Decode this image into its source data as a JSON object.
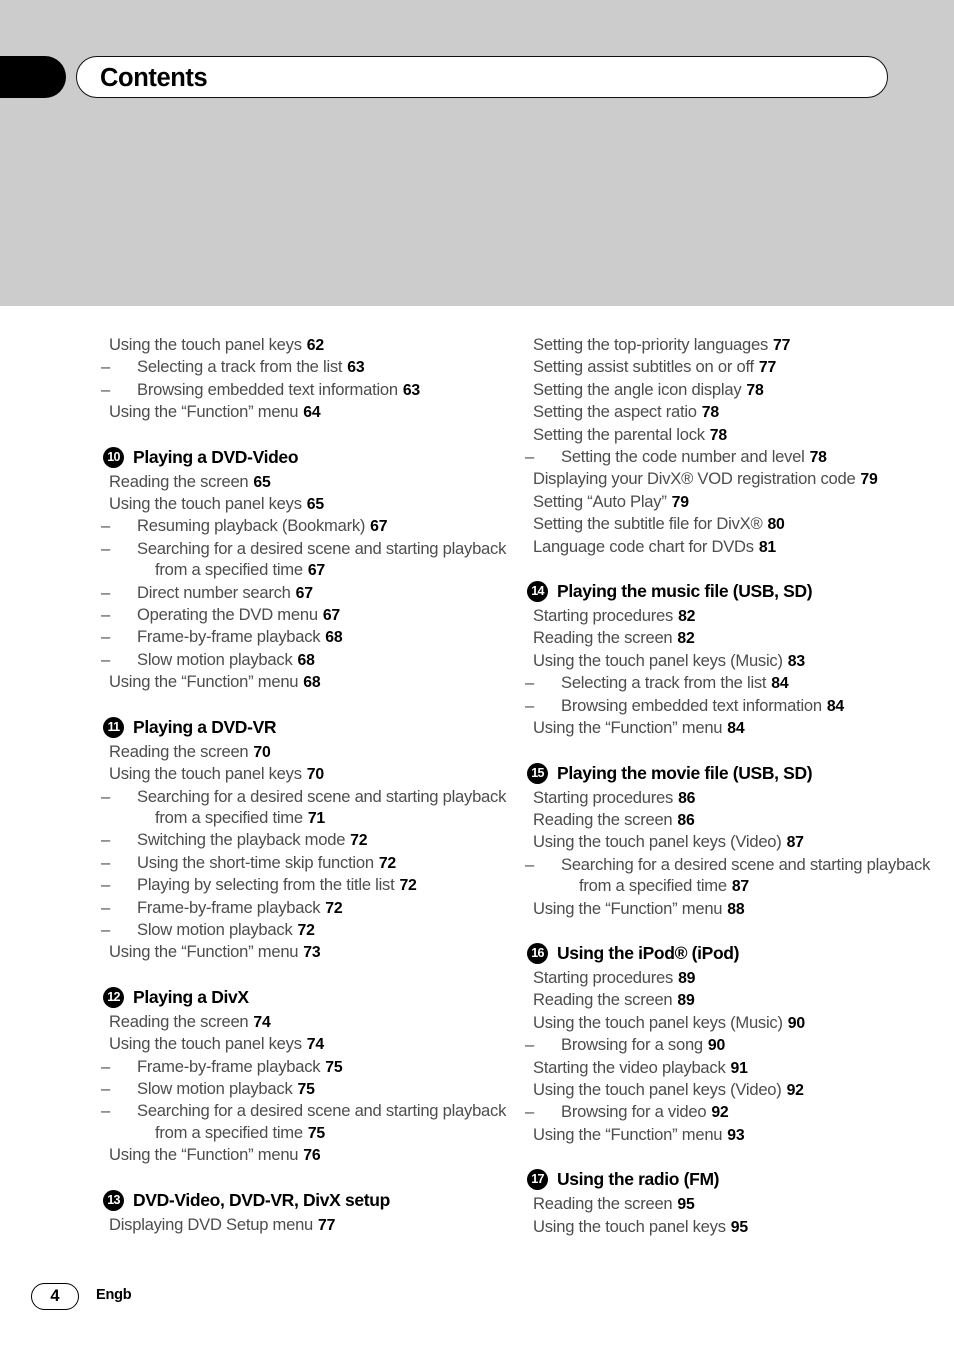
{
  "header": {
    "title": "Contents"
  },
  "footer": {
    "page_number": "4",
    "language_code": "Engb"
  },
  "columns": [
    {
      "name": "left-column",
      "sections": [
        {
          "badge": null,
          "title": null,
          "spaced": false,
          "entries": [
            {
              "level": 1,
              "text": "Using the touch panel keys",
              "page": "62"
            },
            {
              "level": 2,
              "text": "Selecting a track from the list",
              "page": "63"
            },
            {
              "level": 2,
              "text": "Browsing embedded text information",
              "page": "63"
            },
            {
              "level": 1,
              "text": "Using the “Function” menu",
              "page": "64"
            }
          ]
        },
        {
          "badge": "10",
          "title": "Playing a DVD-Video",
          "spaced": true,
          "entries": [
            {
              "level": 1,
              "text": "Reading the screen",
              "page": "65"
            },
            {
              "level": 1,
              "text": "Using the touch panel keys",
              "page": "65"
            },
            {
              "level": 2,
              "text": "Resuming playback (Bookmark)",
              "page": "67"
            },
            {
              "level": 2,
              "text": "Searching for a desired scene and starting playback from a specified time",
              "page": "67"
            },
            {
              "level": 2,
              "text": "Direct number search",
              "page": "67"
            },
            {
              "level": 2,
              "text": "Operating the DVD menu",
              "page": "67"
            },
            {
              "level": 2,
              "text": "Frame-by-frame playback",
              "page": "68"
            },
            {
              "level": 2,
              "text": "Slow motion playback",
              "page": "68"
            },
            {
              "level": 1,
              "text": "Using the “Function” menu",
              "page": "68"
            }
          ]
        },
        {
          "badge": "11",
          "title": "Playing a DVD-VR",
          "spaced": true,
          "entries": [
            {
              "level": 1,
              "text": "Reading the screen",
              "page": "70"
            },
            {
              "level": 1,
              "text": "Using the touch panel keys",
              "page": "70"
            },
            {
              "level": 2,
              "text": "Searching for a desired scene and starting playback from a specified time",
              "page": "71"
            },
            {
              "level": 2,
              "text": "Switching the playback mode",
              "page": "72"
            },
            {
              "level": 2,
              "text": "Using the short-time skip function",
              "page": "72"
            },
            {
              "level": 2,
              "text": "Playing by selecting from the title list",
              "page": "72"
            },
            {
              "level": 2,
              "text": "Frame-by-frame playback",
              "page": "72"
            },
            {
              "level": 2,
              "text": "Slow motion playback",
              "page": "72"
            },
            {
              "level": 1,
              "text": "Using the “Function” menu",
              "page": "73"
            }
          ]
        },
        {
          "badge": "12",
          "title": "Playing a DivX",
          "spaced": true,
          "entries": [
            {
              "level": 1,
              "text": "Reading the screen",
              "page": "74"
            },
            {
              "level": 1,
              "text": "Using the touch panel keys",
              "page": "74"
            },
            {
              "level": 2,
              "text": "Frame-by-frame playback",
              "page": "75"
            },
            {
              "level": 2,
              "text": "Slow motion playback",
              "page": "75"
            },
            {
              "level": 2,
              "text": "Searching for a desired scene and starting playback from a specified time",
              "page": "75"
            },
            {
              "level": 1,
              "text": "Using the “Function” menu",
              "page": "76"
            }
          ]
        },
        {
          "badge": "13",
          "title": "DVD-Video, DVD-VR, DivX setup",
          "spaced": true,
          "entries": [
            {
              "level": 1,
              "text": "Displaying DVD Setup menu",
              "page": "77"
            }
          ]
        }
      ]
    },
    {
      "name": "right-column",
      "sections": [
        {
          "badge": null,
          "title": null,
          "spaced": false,
          "entries": [
            {
              "level": 1,
              "text": "Setting the top-priority languages",
              "page": "77"
            },
            {
              "level": 1,
              "text": "Setting assist subtitles on or off",
              "page": "77"
            },
            {
              "level": 1,
              "text": "Setting the angle icon display",
              "page": "78"
            },
            {
              "level": 1,
              "text": "Setting the aspect ratio",
              "page": "78"
            },
            {
              "level": 1,
              "text": "Setting the parental lock",
              "page": "78"
            },
            {
              "level": 2,
              "text": "Setting the code number and level",
              "page": "78"
            },
            {
              "level": 1,
              "text": "Displaying your DivX® VOD registration code",
              "page": "79"
            },
            {
              "level": 1,
              "text": "Setting “Auto Play”",
              "page": "79"
            },
            {
              "level": 1,
              "text": "Setting the subtitle file for DivX®",
              "page": "80"
            },
            {
              "level": 1,
              "text": "Language code chart for DVDs",
              "page": "81"
            }
          ]
        },
        {
          "badge": "14",
          "title": "Playing the music file (USB, SD)",
          "spaced": true,
          "entries": [
            {
              "level": 1,
              "text": "Starting procedures",
              "page": "82"
            },
            {
              "level": 1,
              "text": "Reading the screen",
              "page": "82"
            },
            {
              "level": 1,
              "text": "Using the touch panel keys (Music)",
              "page": "83"
            },
            {
              "level": 2,
              "text": "Selecting a track from the list",
              "page": "84"
            },
            {
              "level": 2,
              "text": "Browsing embedded text information",
              "page": "84"
            },
            {
              "level": 1,
              "text": "Using the “Function” menu",
              "page": "84"
            }
          ]
        },
        {
          "badge": "15",
          "title": "Playing the movie file (USB, SD)",
          "spaced": true,
          "entries": [
            {
              "level": 1,
              "text": "Starting procedures",
              "page": "86"
            },
            {
              "level": 1,
              "text": "Reading the screen",
              "page": "86"
            },
            {
              "level": 1,
              "text": "Using the touch panel keys (Video)",
              "page": "87"
            },
            {
              "level": 2,
              "text": "Searching for a desired scene and starting playback from a specified time",
              "page": "87"
            },
            {
              "level": 1,
              "text": "Using the “Function” menu",
              "page": "88"
            }
          ]
        },
        {
          "badge": "16",
          "title": "Using the iPod® (iPod)",
          "spaced": true,
          "entries": [
            {
              "level": 1,
              "text": "Starting procedures",
              "page": "89"
            },
            {
              "level": 1,
              "text": "Reading the screen",
              "page": "89"
            },
            {
              "level": 1,
              "text": "Using the touch panel keys (Music)",
              "page": "90"
            },
            {
              "level": 2,
              "text": "Browsing for a song",
              "page": "90"
            },
            {
              "level": 1,
              "text": "Starting the video playback",
              "page": "91"
            },
            {
              "level": 1,
              "text": "Using the touch panel keys (Video)",
              "page": "92"
            },
            {
              "level": 2,
              "text": "Browsing for a video",
              "page": "92"
            },
            {
              "level": 1,
              "text": "Using the “Function” menu",
              "page": "93"
            }
          ]
        },
        {
          "badge": "17",
          "title": "Using the radio (FM)",
          "spaced": true,
          "entries": [
            {
              "level": 1,
              "text": "Reading the screen",
              "page": "95"
            },
            {
              "level": 1,
              "text": "Using the touch panel keys",
              "page": "95"
            }
          ]
        }
      ]
    }
  ]
}
